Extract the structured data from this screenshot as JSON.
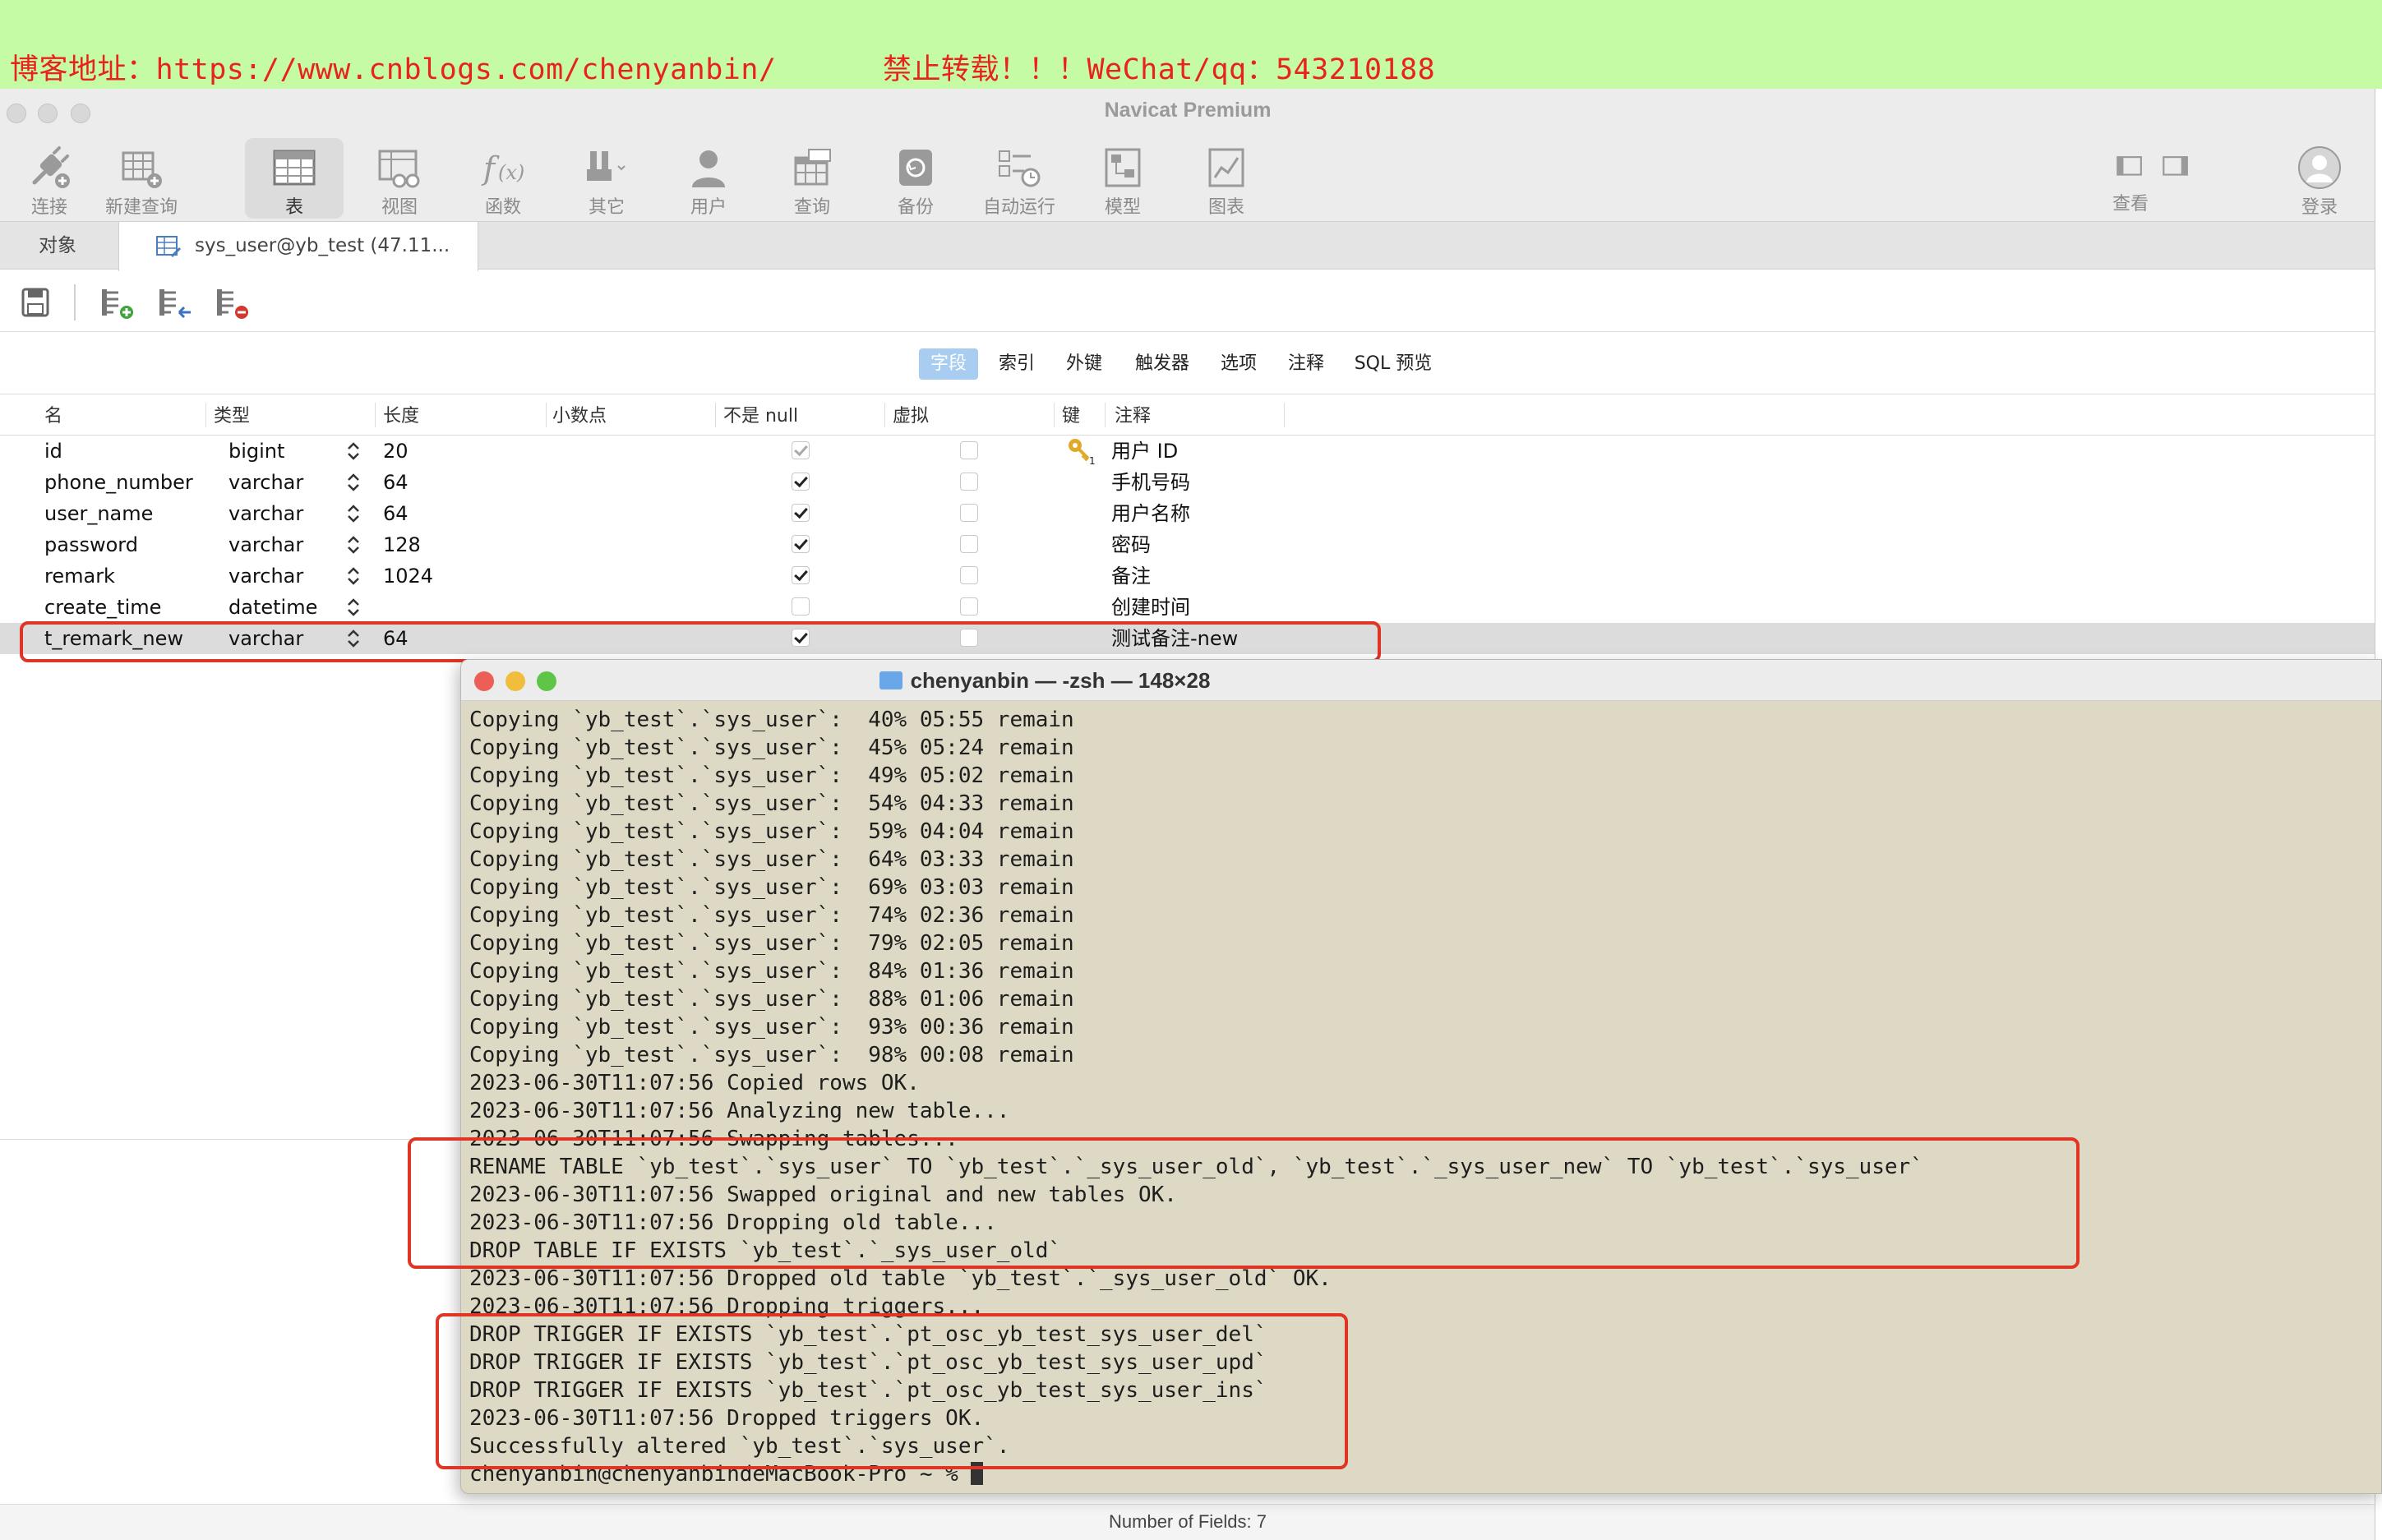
{
  "banner": {
    "text": "博客地址：https://www.cnblogs.com/chenyanbin/      禁止转载！！！WeChat/qq：543210188"
  },
  "app": {
    "window_title": "Navicat Premium",
    "toolbar": [
      {
        "label": "连接",
        "icon": "plug-icon"
      },
      {
        "label": "新建查询",
        "icon": "new-query-icon"
      },
      {
        "label": "表",
        "icon": "table-icon"
      },
      {
        "label": "视图",
        "icon": "view-icon"
      },
      {
        "label": "函数",
        "icon": "function-icon"
      },
      {
        "label": "其它",
        "icon": "tools-icon"
      },
      {
        "label": "用户",
        "icon": "user-icon"
      },
      {
        "label": "查询",
        "icon": "query-icon"
      },
      {
        "label": "备份",
        "icon": "backup-icon"
      },
      {
        "label": "自动运行",
        "icon": "schedule-icon"
      },
      {
        "label": "模型",
        "icon": "model-icon"
      },
      {
        "label": "图表",
        "icon": "chart-icon"
      }
    ],
    "toolbar_right": {
      "view_label": "查看",
      "login_label": "登录"
    },
    "tabs": {
      "objects": "对象",
      "document": "sys_user@yb_test (47.11..."
    },
    "segments": [
      "字段",
      "索引",
      "外键",
      "触发器",
      "选项",
      "注释",
      "SQL 预览"
    ],
    "columns": [
      "名",
      "类型",
      "长度",
      "小数点",
      "不是 null",
      "虚拟",
      "键",
      "注释"
    ],
    "fields": [
      {
        "name": "id",
        "type": "bigint",
        "length": "20",
        "not_null": true,
        "virtual": false,
        "key": true,
        "comment": "用户 ID"
      },
      {
        "name": "phone_number",
        "type": "varchar",
        "length": "64",
        "not_null": true,
        "virtual": false,
        "key": false,
        "comment": "手机号码"
      },
      {
        "name": "user_name",
        "type": "varchar",
        "length": "64",
        "not_null": true,
        "virtual": false,
        "key": false,
        "comment": "用户名称"
      },
      {
        "name": "password",
        "type": "varchar",
        "length": "128",
        "not_null": true,
        "virtual": false,
        "key": false,
        "comment": "密码"
      },
      {
        "name": "remark",
        "type": "varchar",
        "length": "1024",
        "not_null": true,
        "virtual": false,
        "key": false,
        "comment": "备注"
      },
      {
        "name": "create_time",
        "type": "datetime",
        "length": "",
        "not_null": false,
        "virtual": false,
        "key": false,
        "comment": "创建时间"
      },
      {
        "name": "t_remark_new",
        "type": "varchar",
        "length": "64",
        "not_null": true,
        "virtual": false,
        "key": false,
        "comment": "测试备注-new"
      }
    ],
    "status": "Number of Fields: 7"
  },
  "terminal": {
    "title": "chenyanbin — -zsh — 148×28",
    "lines": [
      "Copying `yb_test`.`sys_user`:  40% 05:55 remain",
      "Copying `yb_test`.`sys_user`:  45% 05:24 remain",
      "Copying `yb_test`.`sys_user`:  49% 05:02 remain",
      "Copying `yb_test`.`sys_user`:  54% 04:33 remain",
      "Copying `yb_test`.`sys_user`:  59% 04:04 remain",
      "Copying `yb_test`.`sys_user`:  64% 03:33 remain",
      "Copying `yb_test`.`sys_user`:  69% 03:03 remain",
      "Copying `yb_test`.`sys_user`:  74% 02:36 remain",
      "Copying `yb_test`.`sys_user`:  79% 02:05 remain",
      "Copying `yb_test`.`sys_user`:  84% 01:36 remain",
      "Copying `yb_test`.`sys_user`:  88% 01:06 remain",
      "Copying `yb_test`.`sys_user`:  93% 00:36 remain",
      "Copying `yb_test`.`sys_user`:  98% 00:08 remain",
      "2023-06-30T11:07:56 Copied rows OK.",
      "2023-06-30T11:07:56 Analyzing new table...",
      "2023-06-30T11:07:56 Swapping tables...",
      "RENAME TABLE `yb_test`.`sys_user` TO `yb_test`.`_sys_user_old`, `yb_test`.`_sys_user_new` TO `yb_test`.`sys_user`",
      "2023-06-30T11:07:56 Swapped original and new tables OK.",
      "2023-06-30T11:07:56 Dropping old table...",
      "DROP TABLE IF EXISTS `yb_test`.`_sys_user_old`",
      "2023-06-30T11:07:56 Dropped old table `yb_test`.`_sys_user_old` OK.",
      "2023-06-30T11:07:56 Dropping triggers...",
      "DROP TRIGGER IF EXISTS `yb_test`.`pt_osc_yb_test_sys_user_del`",
      "DROP TRIGGER IF EXISTS `yb_test`.`pt_osc_yb_test_sys_user_upd`",
      "DROP TRIGGER IF EXISTS `yb_test`.`pt_osc_yb_test_sys_user_ins`",
      "2023-06-30T11:07:56 Dropped triggers OK.",
      "Successfully altered `yb_test`.`sys_user`.",
      "chenyanbin@chenyanbindeMacBook-Pro ~ % "
    ]
  },
  "colors": {
    "banner_bg": "#c5fba5",
    "banner_text": "#e8231e",
    "highlight_box": "#e03424",
    "terminal_bg": "#ddd9c4",
    "segment_active": "#a8cdf0"
  }
}
